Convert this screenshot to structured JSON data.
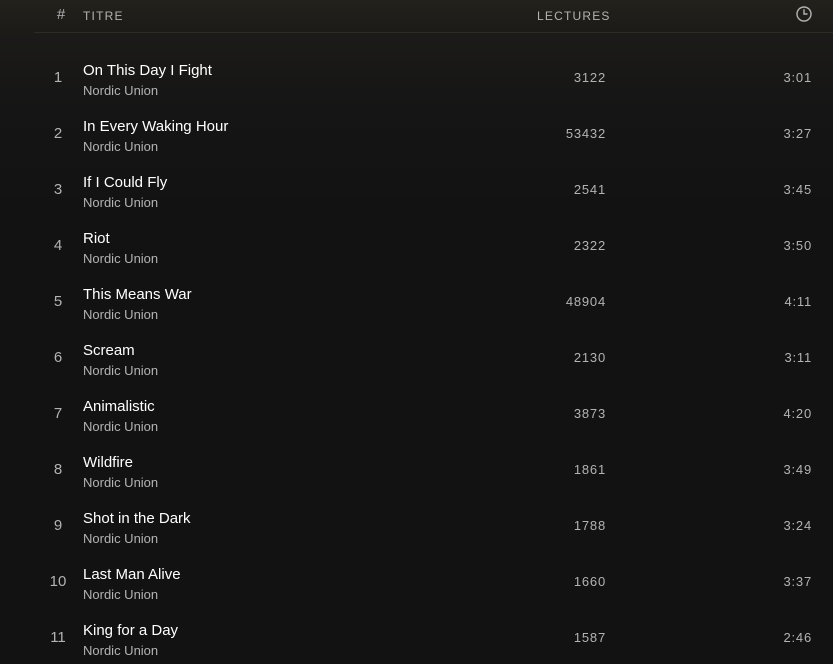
{
  "header": {
    "number_label": "#",
    "title_label": "TITRE",
    "plays_label": "LECTURES",
    "duration_icon": "clock-icon"
  },
  "colors": {
    "text_primary": "#ffffff",
    "text_secondary": "#b3b3b3",
    "background": "#121212"
  },
  "tracks": [
    {
      "number": "1",
      "title": "On This Day I Fight",
      "artist": "Nordic Union",
      "plays": "3122",
      "duration": "3:01"
    },
    {
      "number": "2",
      "title": "In Every Waking Hour",
      "artist": "Nordic Union",
      "plays": "53432",
      "duration": "3:27"
    },
    {
      "number": "3",
      "title": "If I Could Fly",
      "artist": "Nordic Union",
      "plays": "2541",
      "duration": "3:45"
    },
    {
      "number": "4",
      "title": "Riot",
      "artist": "Nordic Union",
      "plays": "2322",
      "duration": "3:50"
    },
    {
      "number": "5",
      "title": "This Means War",
      "artist": "Nordic Union",
      "plays": "48904",
      "duration": "4:11"
    },
    {
      "number": "6",
      "title": "Scream",
      "artist": "Nordic Union",
      "plays": "2130",
      "duration": "3:11"
    },
    {
      "number": "7",
      "title": "Animalistic",
      "artist": "Nordic Union",
      "plays": "3873",
      "duration": "4:20"
    },
    {
      "number": "8",
      "title": "Wildfire",
      "artist": "Nordic Union",
      "plays": "1861",
      "duration": "3:49"
    },
    {
      "number": "9",
      "title": "Shot in the Dark",
      "artist": "Nordic Union",
      "plays": "1788",
      "duration": "3:24"
    },
    {
      "number": "10",
      "title": "Last Man Alive",
      "artist": "Nordic Union",
      "plays": "1660",
      "duration": "3:37"
    },
    {
      "number": "11",
      "title": "King for a Day",
      "artist": "Nordic Union",
      "plays": "1587",
      "duration": "2:46"
    }
  ]
}
